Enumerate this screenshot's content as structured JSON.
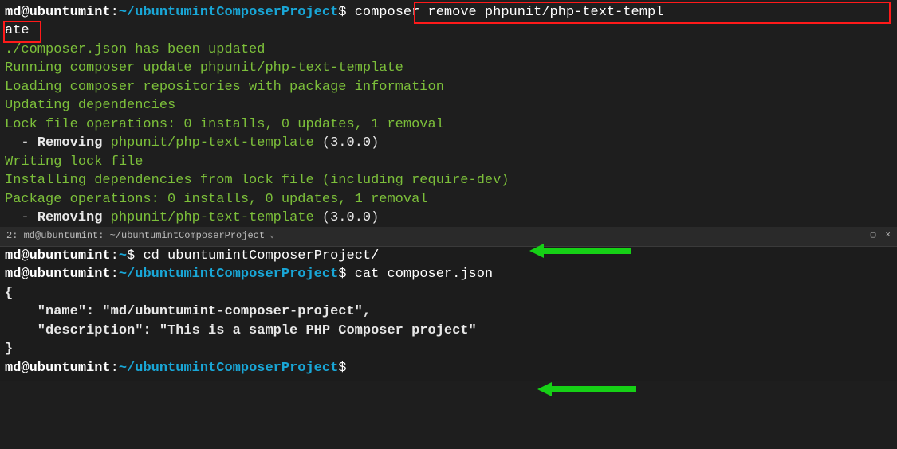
{
  "top": {
    "prompt1": {
      "user": "md",
      "at": "@",
      "host": "ubuntumint",
      "colon": ":",
      "path": "~/ubuntumintComposerProject",
      "dollar": "$",
      "cmd_part1": "composer remove phpunit/php-text-templ",
      "cmd_part2": "ate"
    },
    "out": {
      "l1": "./composer.json has been updated",
      "l2": "Running composer update phpunit/php-text-template",
      "l3": "Loading composer repositories with package information",
      "l4": "Updating dependencies",
      "l5": "Lock file operations: 0 installs, 0 updates, 1 removal",
      "l6_prefix": "  - ",
      "l6_removing": "Removing ",
      "l6_pkg": "phpunit/php-text-template ",
      "l6_ver_open": "(",
      "l6_ver": "3.0.0",
      "l6_ver_close": ")",
      "l7": "Writing lock file",
      "l8": "Installing dependencies from lock file (including require-dev)",
      "l9": "Package operations: 0 installs, 0 updates, 1 removal",
      "l10_prefix": "  - ",
      "l10_removing": "Removing ",
      "l10_pkg": "phpunit/php-text-template ",
      "l10_ver_open": "(",
      "l10_ver": "3.0.0",
      "l10_ver_close": ")"
    }
  },
  "bottom_header": {
    "title": "2: md@ubuntumint: ~/ubuntumintComposerProject",
    "icons": {
      "square": "▢",
      "close": "×"
    }
  },
  "bottom": {
    "prompt1": {
      "user": "md",
      "at": "@",
      "host": "ubuntumint",
      "colon": ":",
      "path": "~",
      "dollar": "$",
      "cmd": "cd ubuntumintComposerProject/"
    },
    "prompt2": {
      "user": "md",
      "at": "@",
      "host": "ubuntumint",
      "colon": ":",
      "path": "~/ubuntumintComposerProject",
      "dollar": "$",
      "cmd": "cat composer.json"
    },
    "json": {
      "open": "{",
      "l1": "    \"name\": \"md/ubuntumint-composer-project\",",
      "l2": "    \"description\": \"This is a sample PHP Composer project\"",
      "close": "}"
    },
    "prompt3": {
      "user": "md",
      "at": "@",
      "host": "ubuntumint",
      "colon": ":",
      "path": "~/ubuntumintComposerProject",
      "dollar": "$"
    }
  }
}
